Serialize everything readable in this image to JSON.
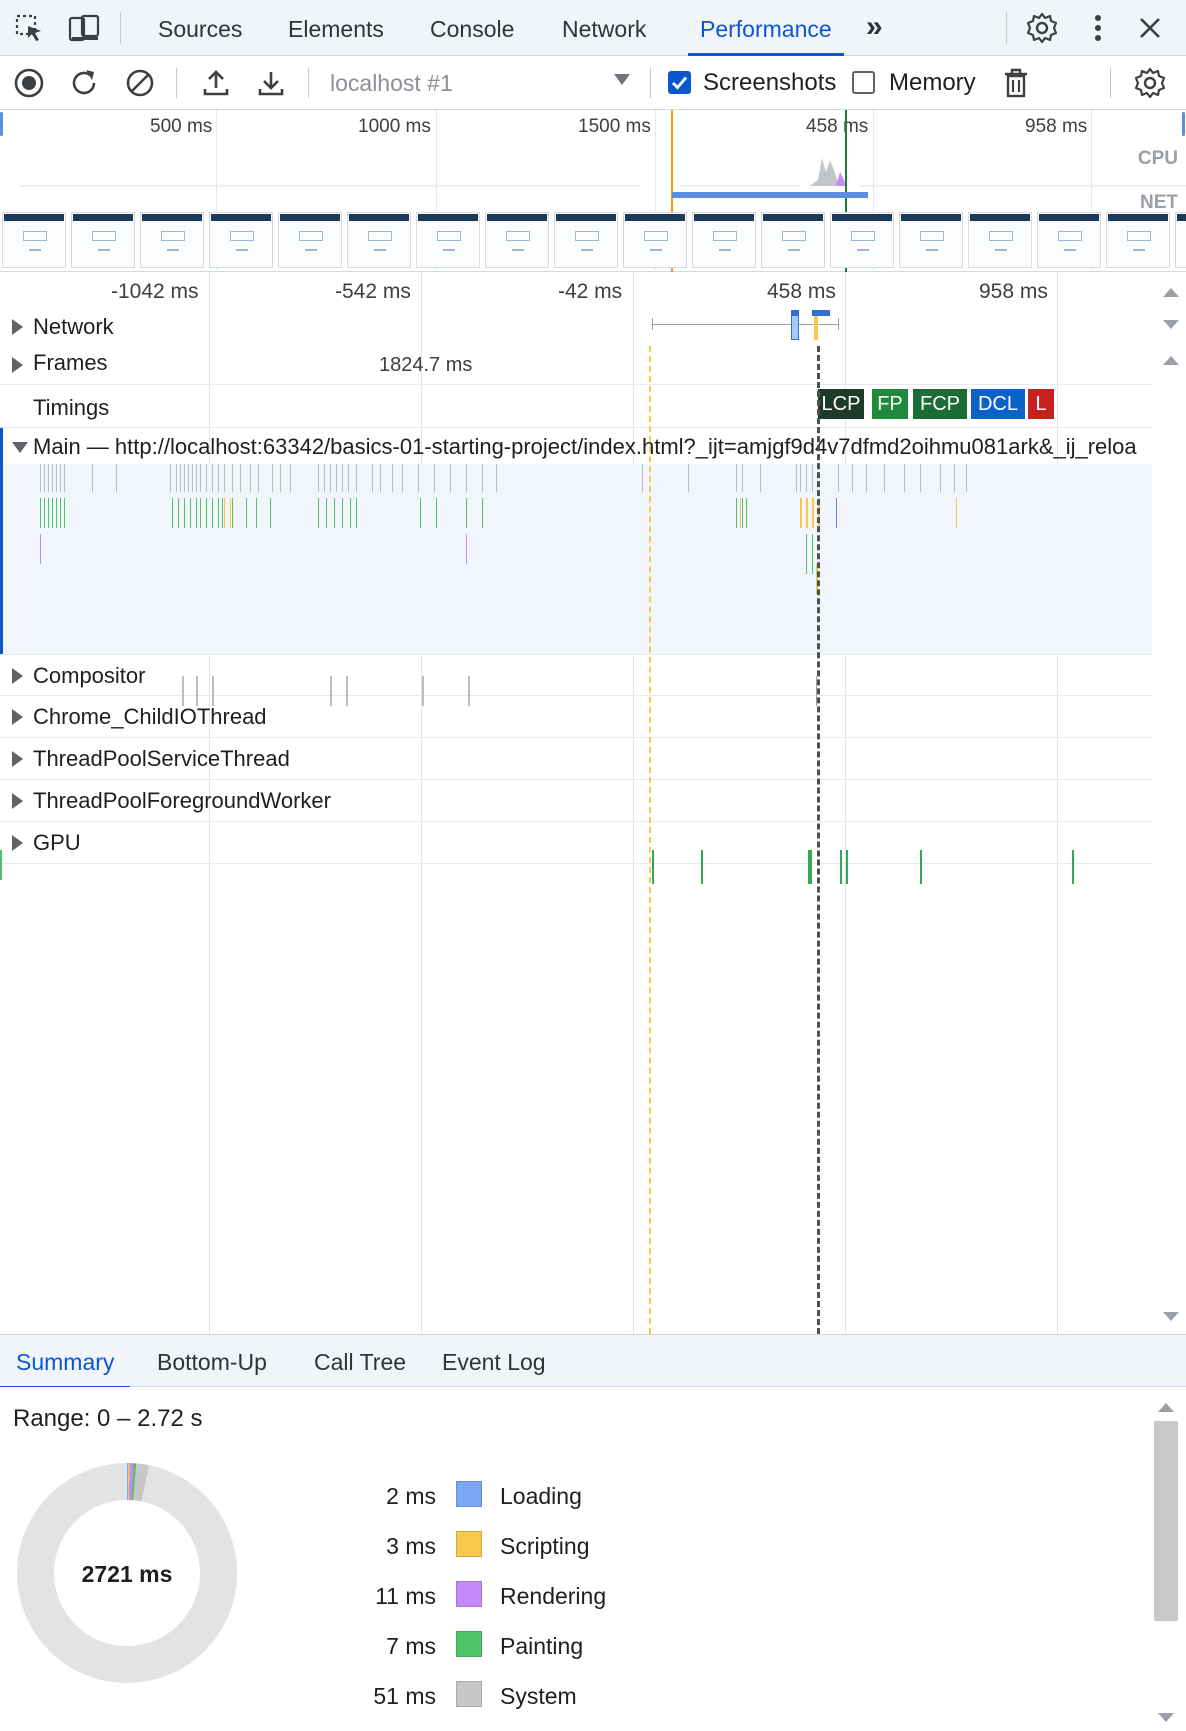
{
  "devtools": {
    "tabs": [
      {
        "label": "Sources"
      },
      {
        "label": "Elements"
      },
      {
        "label": "Console"
      },
      {
        "label": "Network"
      },
      {
        "label": "Performance",
        "active": true
      }
    ],
    "more_tabs_glyph": "»"
  },
  "toolbar": {
    "profile": "localhost #1",
    "screenshots_label": "Screenshots",
    "screenshots_checked": true,
    "memory_label": "Memory",
    "memory_checked": false
  },
  "overview": {
    "labels": [
      "500 ms",
      "1000 ms",
      "1500 ms",
      "458 ms",
      "958 ms"
    ],
    "cpu_label": "CPU",
    "net_label": "NET"
  },
  "ruler": {
    "labels": [
      "-1042 ms",
      "-542 ms",
      "-42 ms",
      "458 ms",
      "958 ms"
    ]
  },
  "tracks": {
    "network": "Network",
    "frames": "Frames",
    "frames_duration": "1824.7 ms",
    "timings": "Timings",
    "main": "Main — http://localhost:63342/basics-01-starting-project/index.html?_ijt=amjgf9d4v7dfmd2oihmu081ark&_ij_reloa",
    "compositor": "Compositor",
    "childio": "Chrome_ChildIOThread",
    "threadpool_service": "ThreadPoolServiceThread",
    "threadpool_foreground": "ThreadPoolForegroundWorker",
    "gpu": "GPU"
  },
  "timings": [
    {
      "label": "LCP",
      "color": "#1e3a2b"
    },
    {
      "label": "FP",
      "color": "#1f8a3b"
    },
    {
      "label": "FCP",
      "color": "#1a6e35"
    },
    {
      "label": "DCL",
      "color": "#0b62c8"
    },
    {
      "label": "L",
      "color": "#c5221f"
    }
  ],
  "bottom_tabs": [
    {
      "label": "Summary",
      "active": true
    },
    {
      "label": "Bottom-Up"
    },
    {
      "label": "Call Tree"
    },
    {
      "label": "Event Log"
    }
  ],
  "summary": {
    "range": "Range: 0 – 2.72 s",
    "total": "2721 ms",
    "legend": [
      {
        "ms": "2 ms",
        "label": "Loading",
        "color": "#7aa8f5"
      },
      {
        "ms": "3 ms",
        "label": "Scripting",
        "color": "#f6c94a"
      },
      {
        "ms": "11 ms",
        "label": "Rendering",
        "color": "#c58af9"
      },
      {
        "ms": "7 ms",
        "label": "Painting",
        "color": "#4ec36a"
      },
      {
        "ms": "51 ms",
        "label": "System",
        "color": "#c7c7c7"
      }
    ]
  }
}
